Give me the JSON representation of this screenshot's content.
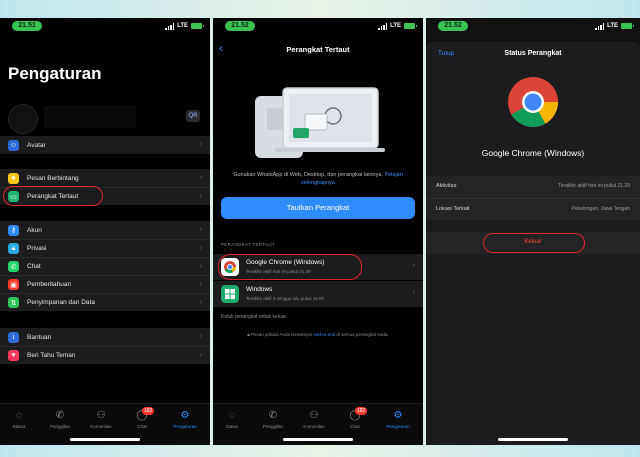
{
  "phone1": {
    "time": "21.51",
    "network": "LTE",
    "title": "Pengaturan",
    "qr_label": "QR",
    "avatar_group": [
      {
        "label": "Avatar",
        "icon": "avatar-icon",
        "color": "#2f6bd8"
      }
    ],
    "group1": [
      {
        "label": "Pesan Berbintang",
        "icon": "star-icon",
        "color": "#f5c518"
      },
      {
        "label": "Perangkat Tertaut",
        "icon": "laptop-icon",
        "color": "#1fb374"
      }
    ],
    "group2": [
      {
        "label": "Akun",
        "icon": "key-icon",
        "color": "#2f8cff"
      },
      {
        "label": "Privasi",
        "icon": "lock-icon",
        "color": "#2aa8e0"
      },
      {
        "label": "Chat",
        "icon": "whatsapp-icon",
        "color": "#25d366"
      },
      {
        "label": "Pemberitahuan",
        "icon": "bell-icon",
        "color": "#ff3b30"
      },
      {
        "label": "Penyimpanan dan Data",
        "icon": "storage-icon",
        "color": "#30c55a"
      }
    ],
    "group3": [
      {
        "label": "Bantuan",
        "icon": "info-icon",
        "color": "#2f6bd8"
      },
      {
        "label": "Beri Tahu Teman",
        "icon": "heart-icon",
        "color": "#ff375f"
      }
    ],
    "tabs": [
      {
        "label": "Status"
      },
      {
        "label": "Panggilan"
      },
      {
        "label": "Komunitas"
      },
      {
        "label": "Chat",
        "badge": "182"
      },
      {
        "label": "Pengaturan"
      }
    ]
  },
  "phone2": {
    "time": "21.52",
    "network": "LTE",
    "title": "Perangkat Tertaut",
    "desc": "Gunakan WhatsApp di Web, Desktop, dan perangkat lainnya.",
    "desc_link": "Pelajari selengkapnya",
    "link_button": "Tautkan Perangkat",
    "section": "PERANGKAT TERTAUT",
    "devices": [
      {
        "name": "Google Chrome (Windows)",
        "sub": "Terakhir aktif hari ini pukul 21.29"
      },
      {
        "name": "Windows",
        "sub": "Terakhir aktif 3 minggu lalu pukul 18.07"
      }
    ],
    "tap_hint": "Ketuk perangkat untuk keluar.",
    "enc_note": "Pesan pribadi Anda terenkripsi",
    "enc_link": "end-to-end",
    "enc_note2": "di semua perangkat Anda.",
    "tabs": [
      {
        "label": "Status"
      },
      {
        "label": "Panggilan"
      },
      {
        "label": "Komunitas"
      },
      {
        "label": "Chat",
        "badge": "182"
      },
      {
        "label": "Pengaturan"
      }
    ]
  },
  "phone3": {
    "time": "21.52",
    "network": "LTE",
    "close": "Tutup",
    "title": "Status Perangkat",
    "device": "Google Chrome (Windows)",
    "info": [
      {
        "key": "Aktivitas",
        "value": "Terakhir aktif hari ini pukul 21.29"
      },
      {
        "key": "Lokasi Terkait",
        "value": "Pekalongan, Jawa Tengah"
      }
    ],
    "logout": "Keluar"
  }
}
